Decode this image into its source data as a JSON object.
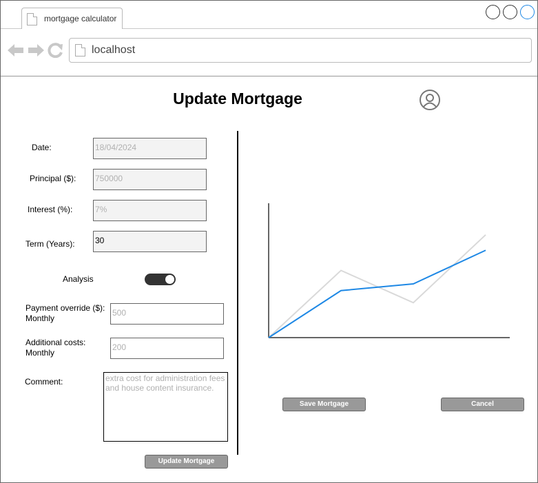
{
  "browser": {
    "tab_title": "mortgage calculator",
    "url": "localhost"
  },
  "page": {
    "title": "Update Mortgage"
  },
  "form": {
    "date": {
      "label": "Date:",
      "value": "18/04/2024"
    },
    "principal": {
      "label": "Principal ($):",
      "value": "750000"
    },
    "interest": {
      "label": "Interest (%):",
      "value": "7%"
    },
    "term": {
      "label": "Term (Years):",
      "value": "30"
    },
    "analysis": {
      "label": "Analysis",
      "enabled": true
    },
    "payment_override": {
      "label_line1": "Payment override ($):",
      "label_line2": "Monthly",
      "placeholder": "500"
    },
    "additional_costs": {
      "label_line1": "Additional costs:",
      "label_line2": "Monthly",
      "placeholder": "200"
    },
    "comment": {
      "label": "Comment:",
      "placeholder": "extra cost for administration fees and house content insurance."
    },
    "update_button": "Update Mortgage"
  },
  "actions": {
    "save_button": "Save Mortgage",
    "cancel_button": "Cancel"
  },
  "chart_data": {
    "type": "line",
    "x": [
      0,
      1,
      2,
      3
    ],
    "series": [
      {
        "color": "#1e88e5",
        "values": [
          0,
          70,
          80,
          130
        ]
      },
      {
        "color": "#d9d9d9",
        "values": [
          0,
          100,
          52,
          153
        ]
      }
    ],
    "title": "",
    "xlabel": "",
    "ylabel": "",
    "ylim": [
      0,
      200
    ],
    "axis_color": "#666666",
    "grid": false
  },
  "colors": {
    "series_primary": "#1e88e5",
    "series_secondary": "#d9d9d9",
    "button_bg": "#999999",
    "toggle_bg": "#333333"
  }
}
